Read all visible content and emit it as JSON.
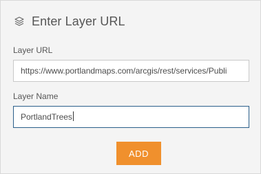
{
  "header": {
    "title": "Enter Layer URL",
    "icon": "layers-icon"
  },
  "form": {
    "url_label": "Layer URL",
    "url_value": "https://www.portlandmaps.com/arcgis/rest/services/Publi",
    "name_label": "Layer Name",
    "name_value": "PortlandTrees",
    "add_label": "ADD"
  },
  "colors": {
    "accent": "#f0902d",
    "focus_border": "#2b5f8a",
    "background": "#f4f4f4"
  }
}
